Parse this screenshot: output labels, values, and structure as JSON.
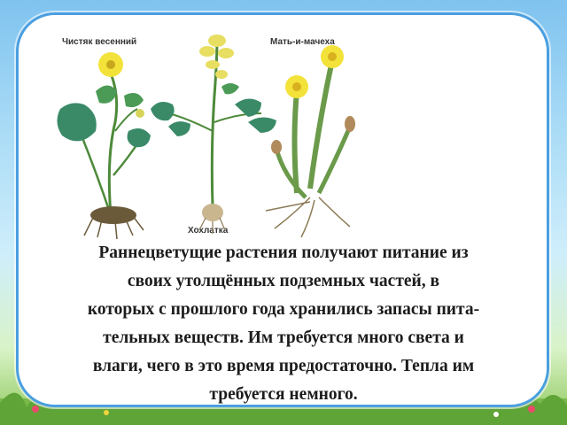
{
  "labels": {
    "plant1": "Чистяк   весенний",
    "plant2": "Мать-и-мачеха",
    "plant3": "Хохлатка"
  },
  "caption": {
    "lines": [
      "Раннецветущие растения получают питание из",
      "своих утолщённых подземных частей, в",
      "которых с прошлого года хранились запасы пита-",
      "тельных веществ. Им требуется много света и",
      "влаги, чего в это время предостаточно. Тепла им",
      "требуется немного."
    ]
  },
  "colors": {
    "frame": "#4a9fe0",
    "leaf": "#3f8f5a",
    "flower": "#f3e23a"
  }
}
